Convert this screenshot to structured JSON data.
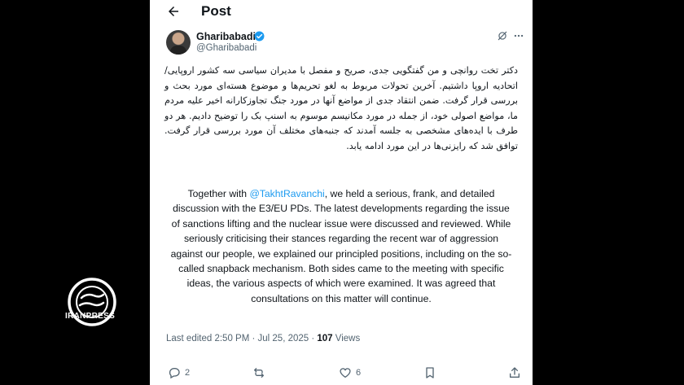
{
  "header": {
    "title": "Post"
  },
  "author": {
    "name": "Gharibabadi",
    "handle": "@Gharibabadi"
  },
  "tweet": {
    "persian": "دکتر تخت روانچی و من گفتگویی جدی، صریح و مفصل با مدیران سیاسی سه کشور اروپایی/اتحادیه اروپا داشتیم. آخرین تحولات مربوط به لغو تحریم‌ها و موضوع هسته‌ای مورد بحث و بررسی قرار گرفت. ضمن انتقاد جدی از مواضع آنها در مورد جنگ تجاوزکارانه اخیر علیه مردم ما، مواضع اصولی خود، از جمله در مورد مکانیسم موسوم به اسنپ بک را توضیح دادیم. هر دو طرف با ایده‌های مشخصی به جلسه آمدند که جنبه‌های مختلف آن مورد بررسی قرار گرفت. توافق شد که رایزنی‌ها در این مورد ادامه یابد.",
    "english_prefix": "Together with ",
    "english_mention": "@TakhtRavanchi",
    "english_body": ", we held a serious, frank, and detailed discussion with the E3/EU PDs. The latest developments regarding the issue of sanctions lifting and the nuclear issue were discussed and reviewed. While seriously criticising their stances regarding the recent war of aggression against our people, we explained our principled positions, including on the so-called snapback mechanism. Both sides came to the meeting with specific ideas, the various aspects of which were examined. It was agreed that consultations on this matter will continue."
  },
  "meta": {
    "edited": "Last edited 2:50 PM · Jul 25, 2025 · ",
    "views_count": "107",
    "views_label": " Views"
  },
  "actions": {
    "replies": "2",
    "reposts": "",
    "likes": "6"
  },
  "watermark": {
    "text": "IRANPRESS"
  },
  "colors": {
    "accent": "#1d9bf0",
    "text": "#0f1419",
    "secondary": "#536471",
    "background": "#ffffff",
    "frame": "#000000"
  },
  "icons": [
    "back-arrow-icon",
    "verified-icon",
    "grok-icon",
    "more-icon",
    "reply-icon",
    "repost-icon",
    "like-icon",
    "bookmark-icon",
    "share-icon",
    "iranpress-logo-icon"
  ]
}
